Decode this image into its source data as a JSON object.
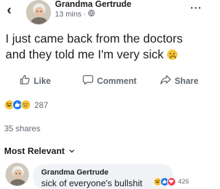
{
  "post": {
    "back_icon": "chevron-left-icon",
    "author": "Grandma Gertrude",
    "time": "13 mins",
    "separator": "·",
    "privacy_icon": "globe-icon",
    "more_icon": "more-dots-icon",
    "more_label": "···",
    "text": "I just came back from the doctors and they told me I'm very sick",
    "emoji": "sad-face-icon"
  },
  "actions": {
    "like_label": "Like",
    "comment_label": "Comment",
    "share_label": "Share"
  },
  "reactions": {
    "icons": [
      "haha-icon",
      "like-icon",
      "sad-icon"
    ],
    "count": "287"
  },
  "shares": "35 shares",
  "comments": {
    "sort_label": "Most Relevant",
    "sort_icon": "chevron-down-icon",
    "items": [
      {
        "author": "Grandma Gertrude",
        "text": "sick of everyone's bullshit",
        "reaction_icons": [
          "haha-icon",
          "like-icon",
          "love-icon"
        ],
        "reaction_count": "426"
      }
    ]
  },
  "colors": {
    "text": "#1c1e21",
    "muted": "#606770",
    "like_blue": "#1877f2",
    "emoji_yellow": "#f5c33b",
    "love_red": "#f33e58",
    "bubble_bg": "#f0f2f5"
  }
}
